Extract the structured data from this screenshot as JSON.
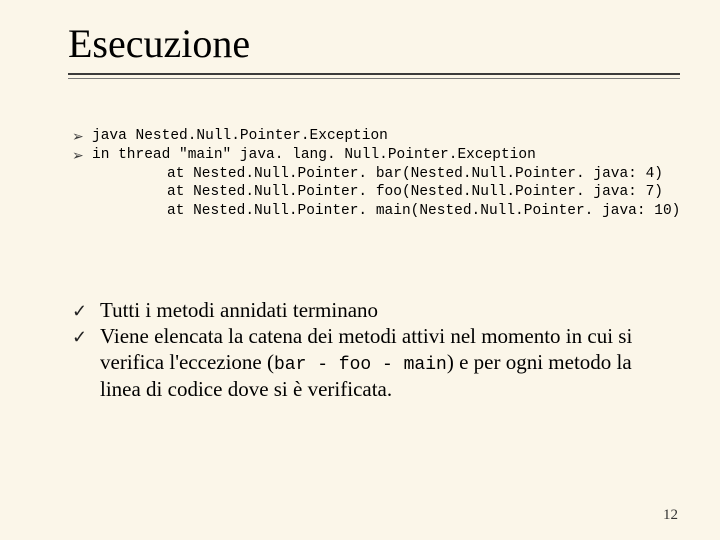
{
  "title": "Esecuzione",
  "code": {
    "line1": "java Nested.Null.Pointer.Exception",
    "line2": "in thread \"main\" java. lang. Null.Pointer.Exception",
    "line3": "at Nested.Null.Pointer. bar(Nested.Null.Pointer. java: 4)",
    "line4": "at Nested.Null.Pointer. foo(Nested.Null.Pointer. java: 7)",
    "line5": "at Nested.Null.Pointer. main(Nested.Null.Pointer. java: 10)"
  },
  "body": {
    "item1": "Tutti i metodi annidati terminano",
    "item2_a": "Viene elencata la catena dei metodi attivi nel momento in cui si verifica l'eccezione (",
    "item2_mono": "bar - foo - main",
    "item2_b": ") e per ogni metodo la linea di codice dove si è verificata."
  },
  "page_number": "12",
  "glyphs": {
    "arrow": "➢",
    "check": "✓"
  }
}
